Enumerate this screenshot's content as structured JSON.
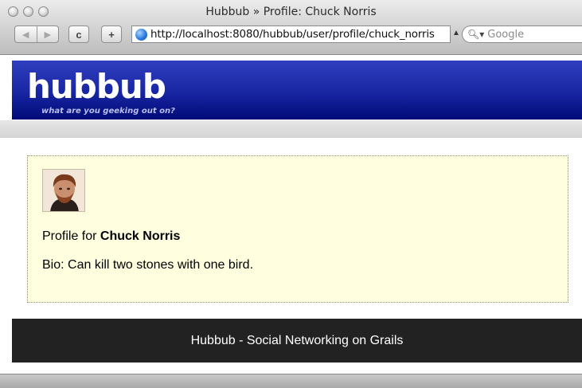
{
  "window": {
    "title": "Hubbub » Profile: Chuck Norris"
  },
  "toolbar": {
    "back_icon": "back-arrow-icon",
    "forward_icon": "forward-arrow-icon",
    "reload_label": "c",
    "add_label": "+",
    "url": "http://localhost:8080/hubbub/user/profile/chuck_norris",
    "search_placeholder": "Google"
  },
  "site": {
    "logo": "hubbub",
    "tagline": "what are you geeking out on?",
    "header_color": "#1b28a6"
  },
  "profile": {
    "prefix": "Profile for ",
    "name": "Chuck Norris",
    "bio": "Bio: Can kill two stones with one bird.",
    "box_color": "#ffffe0"
  },
  "footer": {
    "text": "Hubbub - Social Networking on Grails"
  }
}
